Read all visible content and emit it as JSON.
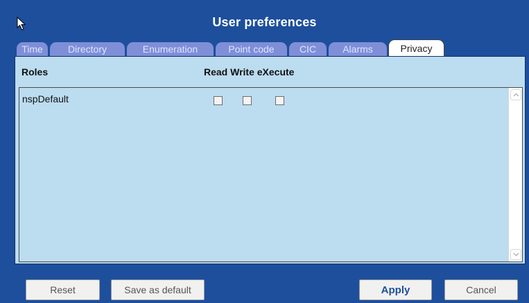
{
  "window": {
    "title": "User preferences"
  },
  "tabs": [
    {
      "label": "Time",
      "active": false
    },
    {
      "label": "Directory",
      "active": false
    },
    {
      "label": "Enumeration",
      "active": false
    },
    {
      "label": "Point code",
      "active": false
    },
    {
      "label": "CIC",
      "active": false
    },
    {
      "label": "Alarms",
      "active": false
    },
    {
      "label": "Privacy",
      "active": true
    }
  ],
  "privacy": {
    "headers": {
      "roles": "Roles",
      "permissions": "Read Write eXecute"
    },
    "rows": [
      {
        "role": "nspDefault",
        "read": false,
        "write": false,
        "execute": false
      }
    ]
  },
  "buttons": {
    "reset": "Reset",
    "save_default": "Save as default",
    "apply": "Apply",
    "cancel": "Cancel"
  },
  "colors": {
    "window_bg": "#1d4f9c",
    "panel_bg": "#bcdcf0",
    "tab_inactive": "#7e8fd8",
    "tab_active": "#ffffff"
  },
  "icons": {
    "cursor": "mouse-pointer-icon",
    "scroll_up": "chevron-up-icon",
    "scroll_down": "chevron-down-icon"
  }
}
